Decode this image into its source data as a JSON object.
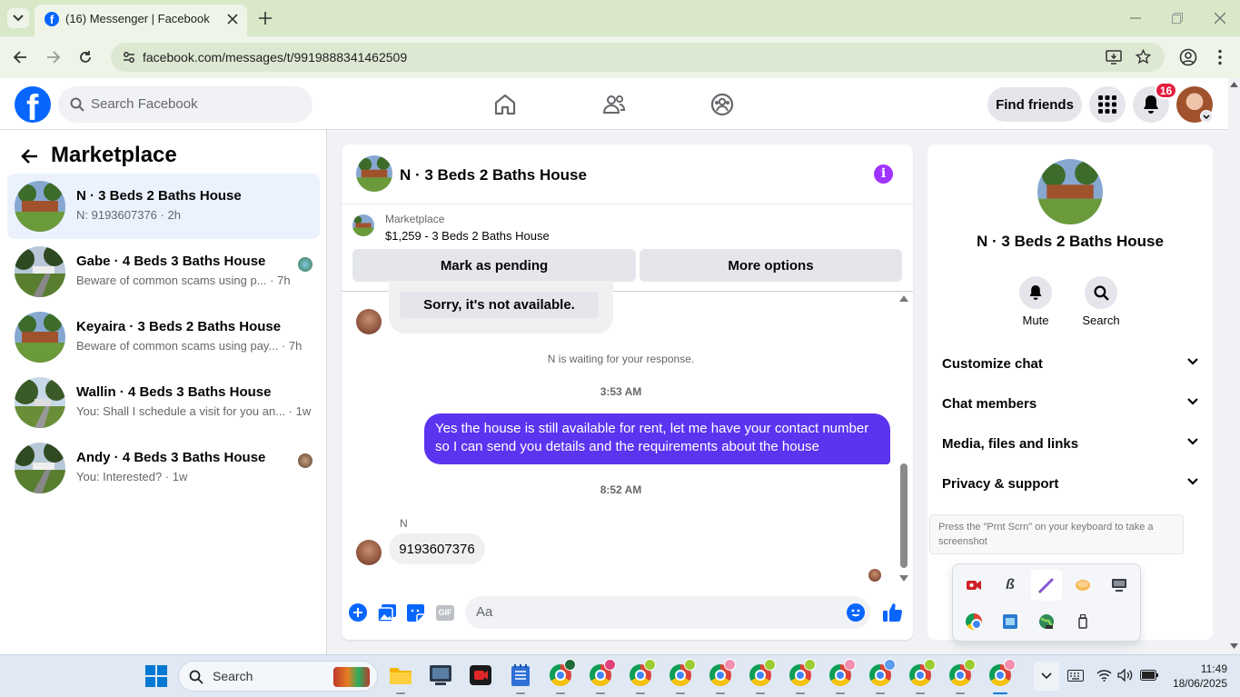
{
  "browser": {
    "tab_title": "(16) Messenger | Facebook",
    "url": "facebook.com/messages/t/9919888341462509"
  },
  "fb": {
    "search_placeholder": "Search Facebook",
    "find_friends": "Find friends",
    "notif_count": "16"
  },
  "left": {
    "title": "Marketplace",
    "conversations": [
      {
        "name": "N · 3 Beds 2 Baths House",
        "preview": "N: 9193607376 · 2h",
        "selected": true
      },
      {
        "name": "Gabe · 4 Beds 3 Baths House",
        "preview": "Beware of common scams using p... · 7h"
      },
      {
        "name": "Keyaira · 3 Beds 2 Baths House",
        "preview": "Beware of common scams using pay... · 7h"
      },
      {
        "name": "Wallin · 4 Beds 3 Baths House",
        "preview": "You: Shall I schedule a visit for you an... · 1w"
      },
      {
        "name": "Andy · 4 Beds 3 Baths House",
        "preview": "You: Interested? · 1w"
      }
    ]
  },
  "chat": {
    "title": "N · 3 Beds 2 Baths House",
    "listing_source": "Marketplace",
    "listing_title": "$1,259 - 3 Beds 2 Baths House",
    "mark_pending": "Mark as pending",
    "more_options": "More options",
    "msg_unavailable": "Sorry, it's not available.",
    "waiting": "N is waiting for your response.",
    "time1": "3:53 AM",
    "sent_msg": "Yes the house is still available for rent, let me have your contact number so I can send you details and the requirements about the house",
    "time2": "8:52 AM",
    "sender_name": "N",
    "received_msg": "9193607376",
    "composer_placeholder": "Aa",
    "gif_label": "GIF"
  },
  "right": {
    "name": "N · 3 Beds 2 Baths House",
    "mute": "Mute",
    "search": "Search",
    "sections": [
      "Customize chat",
      "Chat members",
      "Media, files and links",
      "Privacy & support"
    ]
  },
  "tooltip": "Press the \"Prnt Scrn\" on your keyboard to take a screenshot",
  "taskbar": {
    "search": "Search",
    "time": "11:49",
    "date": "18/06/2025"
  },
  "colors": {
    "fb_blue": "#0866ff",
    "messenger_purple": "#5b34f0",
    "accent_purple": "#a033ff"
  }
}
